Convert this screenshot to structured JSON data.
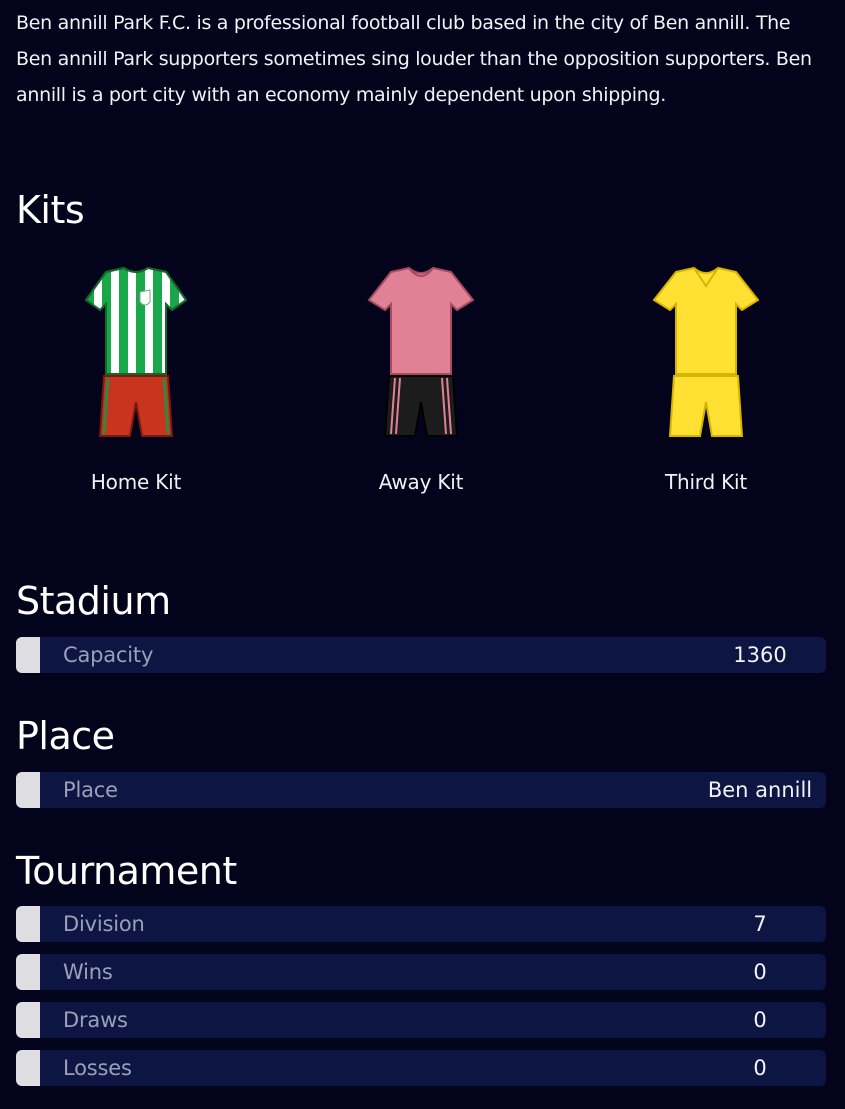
{
  "intro": "Ben annill Park F.C. is a professional football club based in the city of Ben annill. The Ben annill Park supporters sometimes sing louder than the opposition supporters. Ben annill is a port city with an economy mainly dependent upon shipping.",
  "kits": {
    "title": "Kits",
    "items": [
      {
        "label": "Home Kit",
        "shirt_color": "#1aa64a",
        "stripe_color": "#ffffff",
        "shorts_color": "#c8341e",
        "shorts_stripe": "#2e8a3e"
      },
      {
        "label": "Away Kit",
        "shirt_color": "#e08196",
        "shorts_color": "#1c1c1c",
        "shorts_stripe": "#e08196"
      },
      {
        "label": "Third Kit",
        "shirt_color": "#ffe033",
        "shorts_color": "#ffe033"
      }
    ]
  },
  "stadium": {
    "title": "Stadium",
    "rows": [
      {
        "label": "Capacity",
        "value": "1360"
      }
    ]
  },
  "place": {
    "title": "Place",
    "rows": [
      {
        "label": "Place",
        "value": "Ben annill"
      }
    ]
  },
  "tournament": {
    "title": "Tournament",
    "rows": [
      {
        "label": "Division",
        "value": "7"
      },
      {
        "label": "Wins",
        "value": "0"
      },
      {
        "label": "Draws",
        "value": "0"
      },
      {
        "label": "Losses",
        "value": "0"
      }
    ]
  }
}
